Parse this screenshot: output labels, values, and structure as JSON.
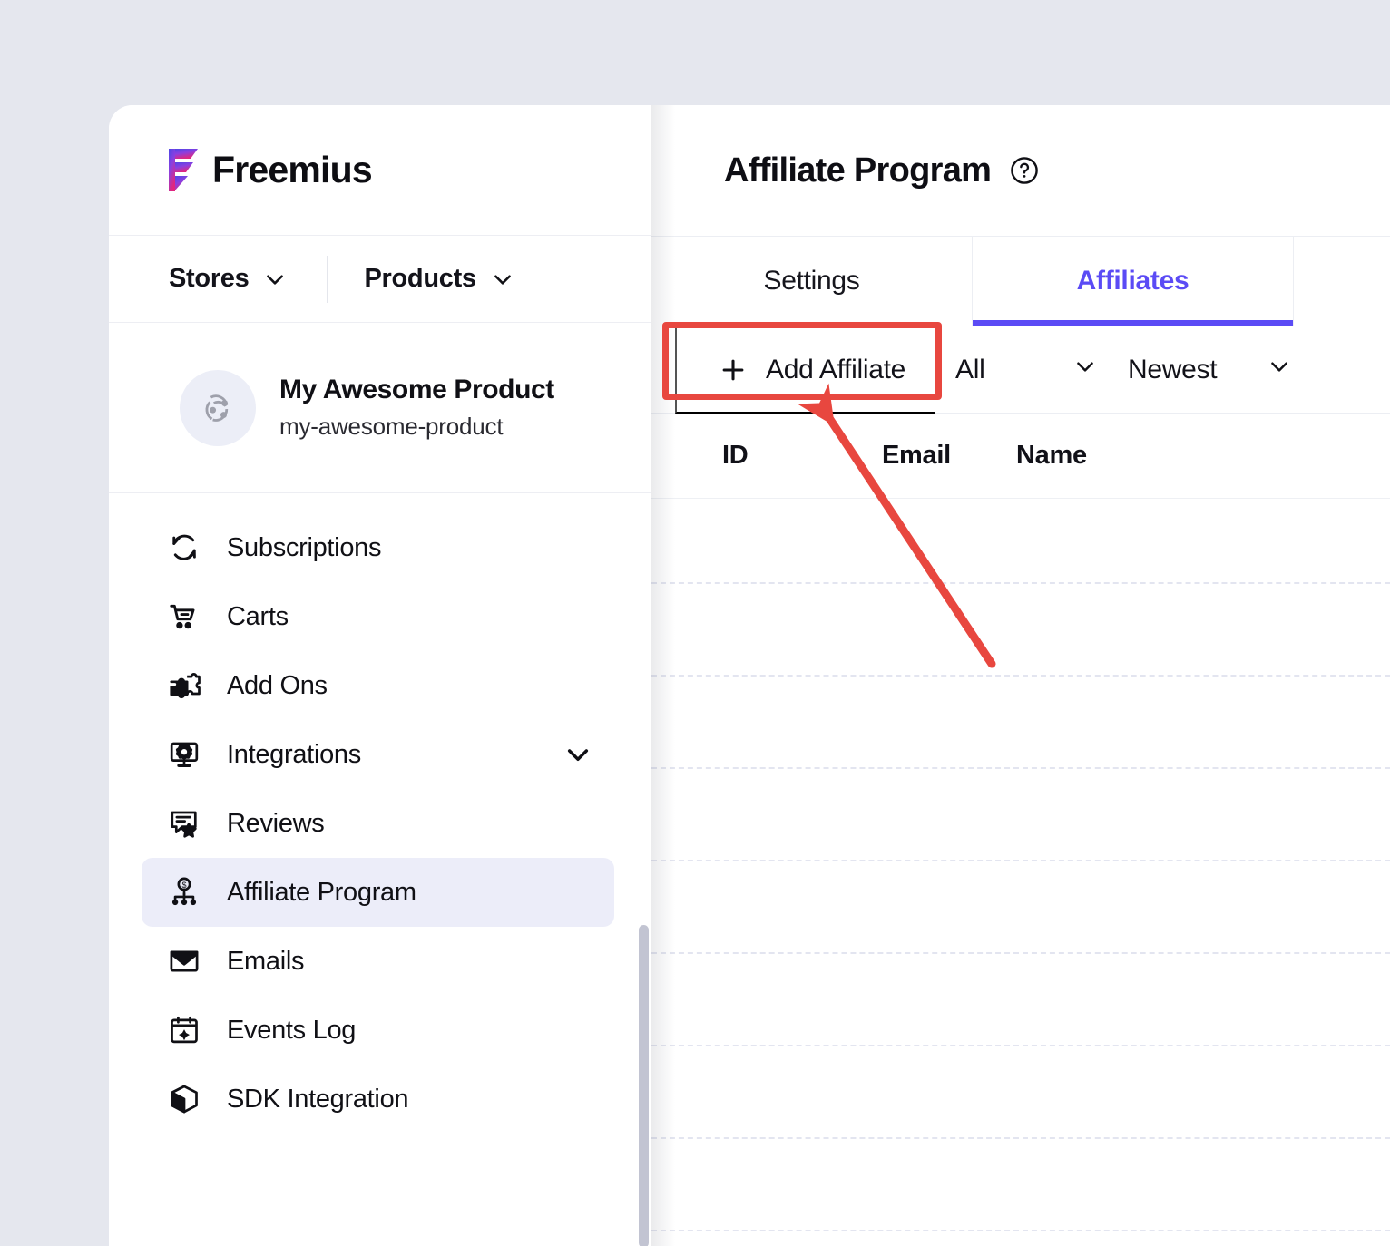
{
  "brand": {
    "name": "Freemius",
    "logo_icon": "freemius-logo-icon",
    "gradient_start": "#4f46e5",
    "gradient_mid": "#8b3fe0",
    "gradient_end": "#e0277f"
  },
  "sidebar": {
    "switchers": [
      {
        "label": "Stores",
        "icon": "chevron-down-icon"
      },
      {
        "label": "Products",
        "icon": "chevron-down-icon"
      }
    ],
    "product": {
      "avatar_icon": "product-avatar-icon",
      "name": "My Awesome Product",
      "slug": "my-awesome-product"
    },
    "items": [
      {
        "label": "Subscriptions",
        "icon": "refresh-cycle-icon",
        "active": false,
        "expandable": false
      },
      {
        "label": "Carts",
        "icon": "shopping-cart-icon",
        "active": false,
        "expandable": false
      },
      {
        "label": "Add Ons",
        "icon": "puzzle-piece-icon",
        "active": false,
        "expandable": false
      },
      {
        "label": "Integrations",
        "icon": "monitor-gear-icon",
        "active": false,
        "expandable": true
      },
      {
        "label": "Reviews",
        "icon": "review-star-icon",
        "active": false,
        "expandable": false
      },
      {
        "label": "Affiliate Program",
        "icon": "affiliate-network-icon",
        "active": true,
        "expandable": false
      },
      {
        "label": "Emails",
        "icon": "envelope-icon",
        "active": false,
        "expandable": false
      },
      {
        "label": "Events Log",
        "icon": "calendar-event-icon",
        "active": false,
        "expandable": false
      },
      {
        "label": "SDK Integration",
        "icon": "cube-box-icon",
        "active": false,
        "expandable": false
      }
    ],
    "active_item_bg": "#ecedf9"
  },
  "main": {
    "header": {
      "title": "Affiliate Program",
      "help_icon": "help-circle-icon"
    },
    "tabs": [
      {
        "label": "Settings",
        "active": false
      },
      {
        "label": "Affiliates",
        "active": true
      }
    ],
    "accent_color": "#5b4bf5",
    "toolbar": {
      "add_button_label": "Add Affiliate",
      "add_button_icon": "plus-icon",
      "filter_value": "All",
      "filter_icon": "chevron-down-icon",
      "sort_value": "Newest",
      "sort_icon": "chevron-down-icon"
    },
    "table": {
      "columns": [
        "ID",
        "Email",
        "Name"
      ],
      "rows": []
    }
  },
  "annotation": {
    "highlight_target": "Add Affiliate",
    "highlight_color": "#e8473f",
    "arrow_color": "#e8473f"
  }
}
